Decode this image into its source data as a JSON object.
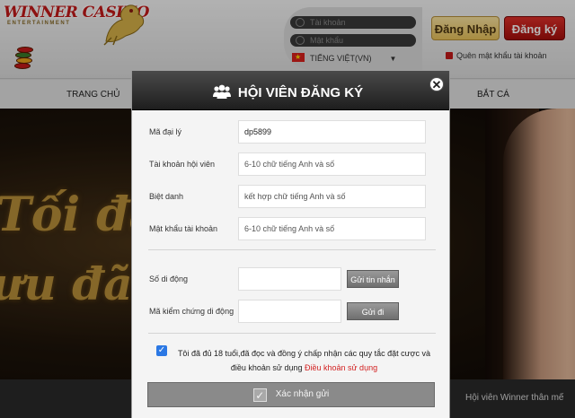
{
  "header": {
    "logo_text": "WINNER CASINO",
    "logo_sub": "ENTERTAINMENT",
    "username_placeholder": "Tài khoản",
    "password_placeholder": "Mật khẩu",
    "language": "TIẾNG VIỆT(VN)",
    "login_label": "Đăng Nhập",
    "register_label": "Đăng ký",
    "forgot_label": "Quên mật khẩu tài khoản"
  },
  "nav": {
    "items": [
      "TRANG CHỦ",
      "BẮT CÁ"
    ]
  },
  "banner": {
    "line1": "Tối đa",
    "line2": "ưu đãi"
  },
  "footer": {
    "ticker": "Hội viên Winner thân mế"
  },
  "modal": {
    "title": "HỘI VIÊN ĐĂNG KÝ",
    "close_symbol": "✕",
    "fields": [
      {
        "label": "Mã đại lý",
        "value": "dp5899",
        "placeholder": ""
      },
      {
        "label": "Tài khoản hội viên",
        "value": "",
        "placeholder": "6-10 chữ tiếng Anh và số"
      },
      {
        "label": "Biệt danh",
        "value": "",
        "placeholder": "kết hợp chữ tiếng Anh và số"
      },
      {
        "label": "Mật khẩu tài khoản",
        "value": "",
        "placeholder": "6-10 chữ tiếng Anh và số"
      }
    ],
    "phone": {
      "label": "Số di động",
      "button": "Gửi tin nhắn"
    },
    "verify": {
      "label": "Mã kiểm chứng di động",
      "button": "Gửi đi"
    },
    "agree": {
      "checked": true,
      "text": "Tôi đã đủ 18 tuổi,đã đọc và đồng ý chấp nhận các quy tắc đặt cược và điều khoản sử dụng",
      "link": "Điều khoản sử dụng"
    },
    "submit_label": "Xác nhận gửi"
  },
  "colors": {
    "register_red": "#c41a1a",
    "login_gold": "#e9c25a",
    "checkbox_blue": "#2b78e4",
    "link_red": "#d21f1f"
  }
}
